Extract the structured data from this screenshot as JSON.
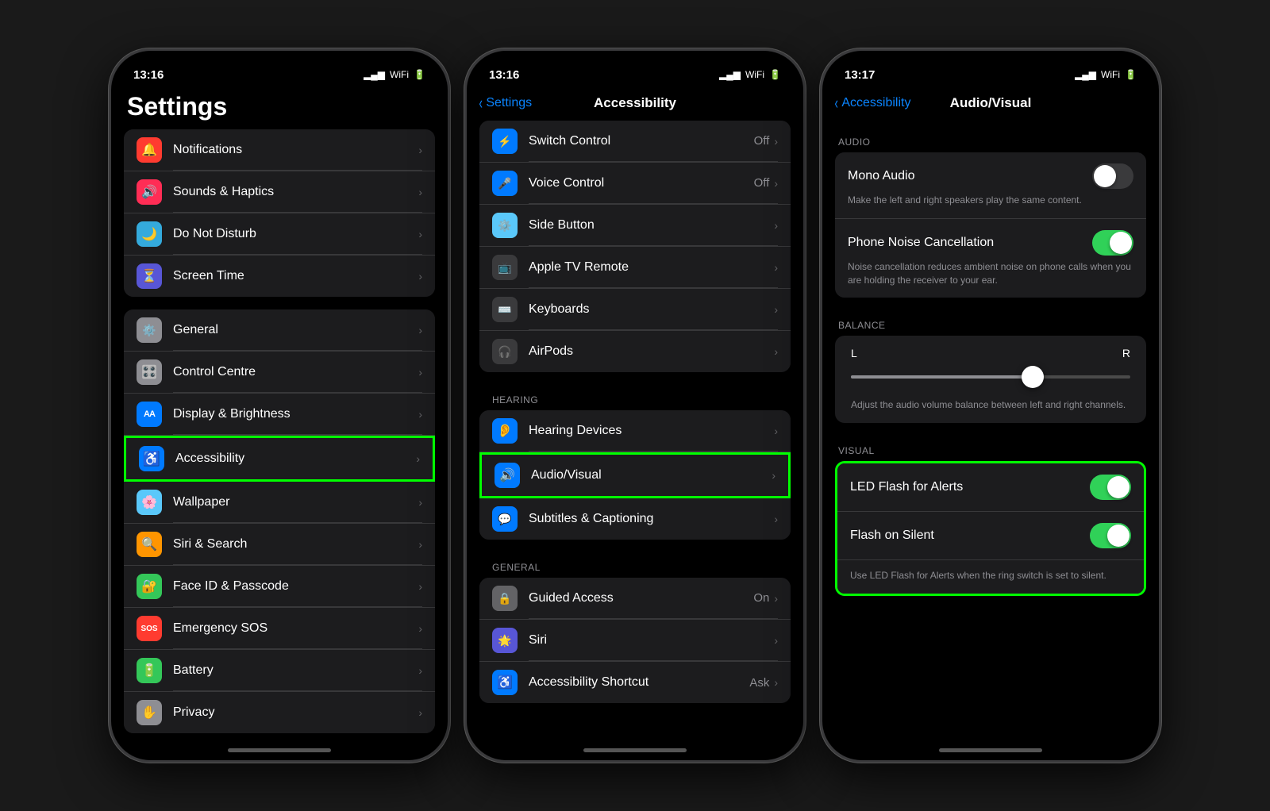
{
  "colors": {
    "accent": "#0a84ff",
    "green": "#30d158",
    "highlight": "#00ff00",
    "bg": "#000000",
    "cell": "#1c1c1e",
    "separator": "#38383a",
    "text_primary": "#ffffff",
    "text_secondary": "#8e8e93",
    "chevron": "#636366"
  },
  "phone1": {
    "status_time": "13:16",
    "status_signal": "▂▄▆",
    "status_wifi": "WiFi",
    "status_battery": "🔋",
    "title": "Settings",
    "groups": [
      {
        "items": [
          {
            "icon": "🔔",
            "icon_bg": "red",
            "label": "Notifications",
            "value": "",
            "id": "notifications"
          },
          {
            "icon": "🔊",
            "icon_bg": "pink",
            "label": "Sounds & Haptics",
            "value": "",
            "id": "sounds"
          },
          {
            "icon": "🌙",
            "icon_bg": "indigo",
            "label": "Do Not Disturb",
            "value": "",
            "id": "dnd"
          },
          {
            "icon": "⏳",
            "icon_bg": "purple",
            "label": "Screen Time",
            "value": "",
            "id": "screen-time"
          }
        ]
      },
      {
        "items": [
          {
            "icon": "⚙️",
            "icon_bg": "gray",
            "label": "General",
            "value": "",
            "id": "general"
          },
          {
            "icon": "🎛️",
            "icon_bg": "gray",
            "label": "Control Centre",
            "value": "",
            "id": "control-centre"
          },
          {
            "icon": "AA",
            "icon_bg": "blue",
            "label": "Display & Brightness",
            "value": "",
            "id": "display",
            "text_icon": true
          },
          {
            "icon": "♿",
            "icon_bg": "blue",
            "label": "Accessibility",
            "value": "",
            "id": "accessibility",
            "highlighted": true
          },
          {
            "icon": "🌸",
            "icon_bg": "teal",
            "label": "Wallpaper",
            "value": "",
            "id": "wallpaper"
          },
          {
            "icon": "🔍",
            "icon_bg": "orange",
            "label": "Siri & Search",
            "value": "",
            "id": "siri"
          },
          {
            "icon": "🔐",
            "icon_bg": "green",
            "label": "Face ID & Passcode",
            "value": "",
            "id": "faceid"
          },
          {
            "icon": "SOS",
            "icon_bg": "red",
            "label": "Emergency SOS",
            "value": "",
            "id": "sos",
            "text_icon": true
          },
          {
            "icon": "🔋",
            "icon_bg": "green",
            "label": "Battery",
            "value": "",
            "id": "battery"
          },
          {
            "icon": "✋",
            "icon_bg": "gray",
            "label": "Privacy",
            "value": "",
            "id": "privacy"
          }
        ]
      }
    ]
  },
  "phone2": {
    "status_time": "13:16",
    "nav_back": "Settings",
    "title": "Accessibility",
    "sections": [
      {
        "items": [
          {
            "icon": "⚡",
            "icon_bg": "blue",
            "label": "Switch Control",
            "value": "Off",
            "id": "switch-control"
          },
          {
            "icon": "🎤",
            "icon_bg": "blue",
            "label": "Voice Control",
            "value": "Off",
            "id": "voice-control"
          },
          {
            "icon": "⚙️",
            "icon_bg": "blue",
            "label": "Side Button",
            "value": "",
            "id": "side-button"
          },
          {
            "icon": "📺",
            "icon_bg": "dark",
            "label": "Apple TV Remote",
            "value": "",
            "id": "apple-tv"
          },
          {
            "icon": "⌨️",
            "icon_bg": "dark",
            "label": "Keyboards",
            "value": "",
            "id": "keyboards"
          },
          {
            "icon": "🎧",
            "icon_bg": "dark",
            "label": "AirPods",
            "value": "",
            "id": "airpods"
          }
        ]
      },
      {
        "header": "HEARING",
        "items": [
          {
            "icon": "👂",
            "icon_bg": "blue",
            "label": "Hearing Devices",
            "value": "",
            "id": "hearing-devices"
          },
          {
            "icon": "🔊",
            "icon_bg": "blue",
            "label": "Audio/Visual",
            "value": "",
            "id": "audio-visual",
            "highlighted": true
          },
          {
            "icon": "💬",
            "icon_bg": "blue",
            "label": "Subtitles & Captioning",
            "value": "",
            "id": "subtitles"
          }
        ]
      },
      {
        "header": "GENERAL",
        "items": [
          {
            "icon": "🔒",
            "icon_bg": "gray",
            "label": "Guided Access",
            "value": "On",
            "id": "guided-access"
          },
          {
            "icon": "🌟",
            "icon_bg": "purple",
            "label": "Siri",
            "value": "",
            "id": "siri-access"
          },
          {
            "icon": "♿",
            "icon_bg": "blue",
            "label": "Accessibility Shortcut",
            "value": "Ask",
            "id": "accessibility-shortcut"
          }
        ]
      }
    ]
  },
  "phone3": {
    "status_time": "13:17",
    "nav_back": "Accessibility",
    "title": "Audio/Visual",
    "audio_section": {
      "header": "AUDIO",
      "items": [
        {
          "label": "Mono Audio",
          "toggle": false,
          "id": "mono-audio",
          "desc": "Make the left and right speakers play the same content."
        },
        {
          "label": "Phone Noise Cancellation",
          "toggle": true,
          "id": "phone-noise",
          "desc": "Noise cancellation reduces ambient noise on phone calls when you are holding the receiver to your ear."
        }
      ]
    },
    "balance_section": {
      "header": "BALANCE",
      "left": "L",
      "right": "R",
      "value": 65,
      "desc": "Adjust the audio volume balance between left and right channels."
    },
    "visual_section": {
      "header": "VISUAL",
      "items": [
        {
          "label": "LED Flash for Alerts",
          "toggle": true,
          "id": "led-flash"
        },
        {
          "label": "Flash on Silent",
          "toggle": true,
          "id": "flash-silent"
        }
      ],
      "desc": "Use LED Flash for Alerts when the ring switch is set to silent.",
      "highlighted": true
    }
  }
}
